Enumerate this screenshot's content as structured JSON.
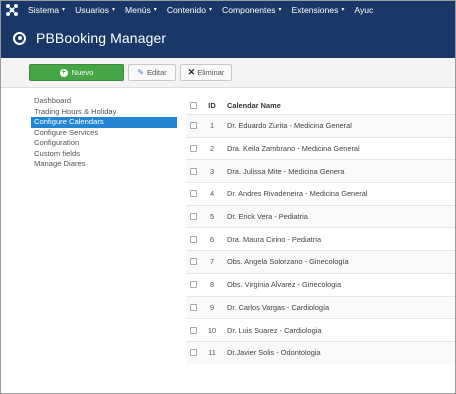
{
  "menu": {
    "items": [
      {
        "label": "Sistema"
      },
      {
        "label": "Usuarios"
      },
      {
        "label": "Menús"
      },
      {
        "label": "Contenido"
      },
      {
        "label": "Componentes"
      },
      {
        "label": "Extensiones"
      },
      {
        "label": "Ayuc"
      }
    ]
  },
  "header": {
    "title": "PBBooking Manager"
  },
  "toolbar": {
    "new_label": "Nuevo",
    "edit_label": "Editar",
    "delete_label": "Eliminar"
  },
  "sidebar": {
    "items": [
      {
        "label": "Dashboard"
      },
      {
        "label": "Trading Hours & Holiday"
      },
      {
        "label": "Configure Calendars"
      },
      {
        "label": "Configure Services"
      },
      {
        "label": "Configuration"
      },
      {
        "label": "Custom fields"
      },
      {
        "label": "Manage Diares"
      }
    ],
    "active_index": 2
  },
  "table": {
    "headers": {
      "id": "ID",
      "name": "Calendar Name"
    },
    "rows": [
      {
        "id": "1",
        "name": "Dr. Eduardo Zurita - Medicina General"
      },
      {
        "id": "2",
        "name": "Dra. Keila Zambrano - Medicina General"
      },
      {
        "id": "3",
        "name": "Dra. Julissa Mite - Medicina Genera"
      },
      {
        "id": "4",
        "name": "Dr. Andres Rivadeneira - Medicina General"
      },
      {
        "id": "5",
        "name": "Dr. Erick Vera - Pediatria"
      },
      {
        "id": "6",
        "name": "Dra. Maura Cirino - Pediatria"
      },
      {
        "id": "7",
        "name": "Obs. Angela Solorzano - Ginecología"
      },
      {
        "id": "8",
        "name": "Obs. Virginia Alvarez - Ginecologia"
      },
      {
        "id": "9",
        "name": "Dr. Carlos Vargas - Cardiología"
      },
      {
        "id": "10",
        "name": "Dr. Luis Suarez - Cardiologia"
      },
      {
        "id": "11",
        "name": "Dr.Javier Solis - Odontologia"
      }
    ]
  },
  "colors": {
    "navy": "#1a3867",
    "green": "#46a546",
    "active_blue": "#2384d3"
  },
  "icons": {
    "logo": "joomla-logo-icon",
    "header": "circle-dot-icon",
    "new": "plus-circle-icon",
    "edit": "pencil-icon",
    "delete": "x-icon"
  }
}
